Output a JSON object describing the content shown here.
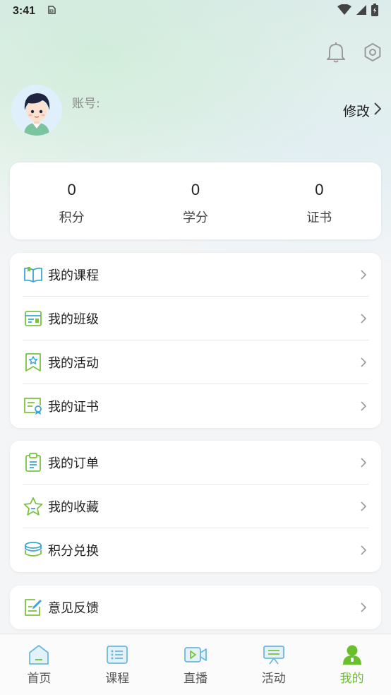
{
  "status_bar": {
    "time": "3:41"
  },
  "header": {
    "account_label": "账号:",
    "edit_label": "修改"
  },
  "stats": [
    {
      "value": "0",
      "label": "积分"
    },
    {
      "value": "0",
      "label": "学分"
    },
    {
      "value": "0",
      "label": "证书"
    }
  ],
  "menu_group_1": [
    {
      "label": "我的课程",
      "icon": "book-open-icon"
    },
    {
      "label": "我的班级",
      "icon": "class-card-icon"
    },
    {
      "label": "我的活动",
      "icon": "activity-bookmark-icon"
    },
    {
      "label": "我的证书",
      "icon": "certificate-icon"
    }
  ],
  "menu_group_2": [
    {
      "label": "我的订单",
      "icon": "clipboard-order-icon"
    },
    {
      "label": "我的收藏",
      "icon": "star-icon"
    },
    {
      "label": "积分兑换",
      "icon": "coins-stack-icon"
    }
  ],
  "menu_group_3": [
    {
      "label": "意见反馈",
      "icon": "feedback-edit-icon"
    }
  ],
  "tabbar": [
    {
      "label": "首页",
      "icon": "home-icon",
      "active": false
    },
    {
      "label": "课程",
      "icon": "course-list-icon",
      "active": false
    },
    {
      "label": "直播",
      "icon": "live-video-icon",
      "active": false
    },
    {
      "label": "活动",
      "icon": "activity-board-icon",
      "active": false
    },
    {
      "label": "我的",
      "icon": "user-profile-icon",
      "active": true
    }
  ],
  "colors": {
    "accent_green": "#6abf2c",
    "icon_blue": "#3aa6d8",
    "icon_green": "#7cc242"
  }
}
